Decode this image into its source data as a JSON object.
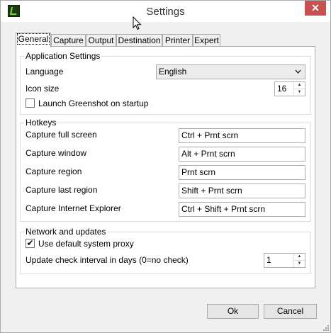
{
  "window": {
    "title": "Settings",
    "close_glyph": "✕"
  },
  "tabs": [
    "General",
    "Capture",
    "Output",
    "Destination",
    "Printer",
    "Expert"
  ],
  "application_settings": {
    "title": "Application Settings",
    "language_label": "Language",
    "language_value": "English",
    "icon_size_label": "Icon size",
    "icon_size_value": "16",
    "launch_label": "Launch Greenshot on startup",
    "launch_checked": false
  },
  "hotkeys": {
    "title": "Hotkeys",
    "rows": [
      {
        "label": "Capture full screen",
        "value": "Ctrl + Prnt scrn"
      },
      {
        "label": "Capture window",
        "value": "Alt + Prnt scrn"
      },
      {
        "label": "Capture region",
        "value": "Prnt scrn"
      },
      {
        "label": "Capture last region",
        "value": "Shift + Prnt scrn"
      },
      {
        "label": "Capture Internet Explorer",
        "value": "Ctrl + Shift + Prnt scrn"
      }
    ]
  },
  "network": {
    "title": "Network and updates",
    "proxy_label": "Use default system proxy",
    "proxy_checked": true,
    "check_checkmark": "✔",
    "interval_label": "Update check interval in days (0=no check)",
    "interval_value": "1"
  },
  "buttons": {
    "ok": "Ok",
    "cancel": "Cancel"
  },
  "icons": {
    "app": "greenshot-app-icon",
    "close": "close-icon",
    "cursor": "mouse-cursor-icon",
    "dropdown": "chevron-down-icon",
    "spin_up": "▲",
    "spin_down": "▼",
    "dropdown_glyph": "⌄"
  }
}
